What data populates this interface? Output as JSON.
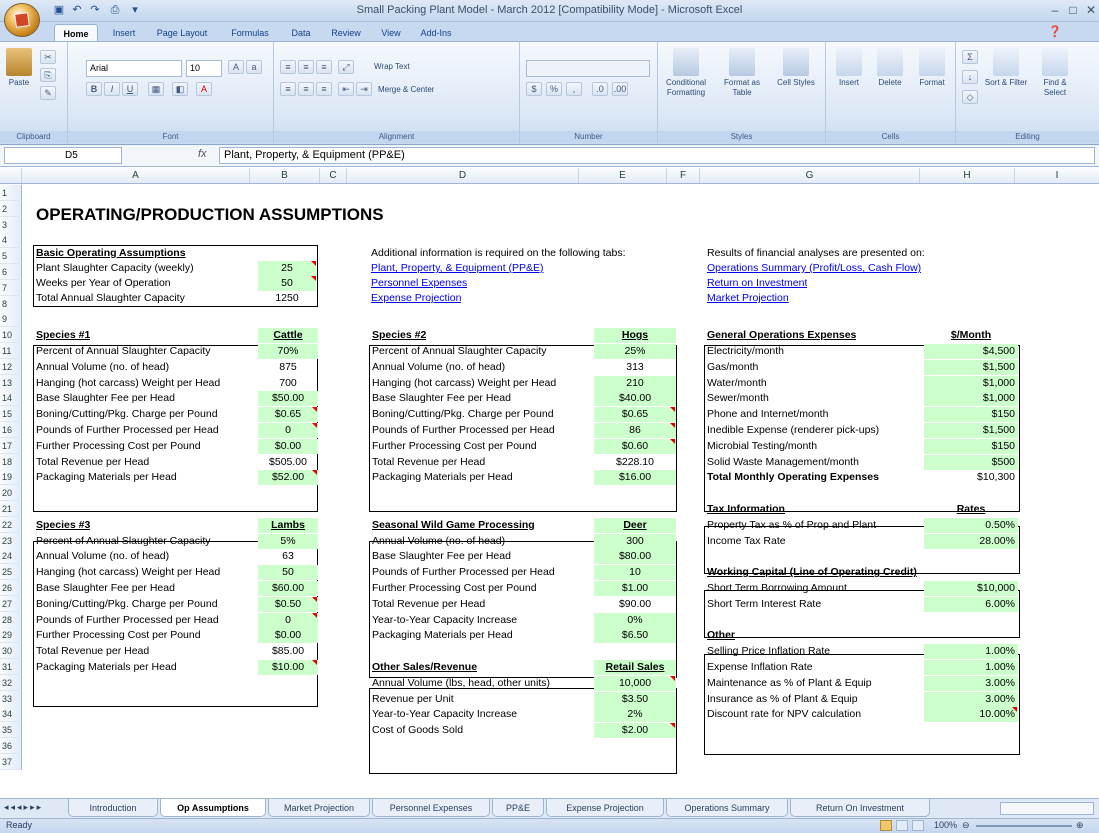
{
  "window": {
    "title": "Small Packing Plant Model - March 2012  [Compatibility Mode] - Microsoft Excel"
  },
  "ribbon_tabs": [
    "Home",
    "Insert",
    "Page Layout",
    "Formulas",
    "Data",
    "Review",
    "View",
    "Add-Ins"
  ],
  "ribbon": {
    "clipboard": {
      "paste": "Paste",
      "label": "Clipboard"
    },
    "font": {
      "name": "Arial",
      "size": "10",
      "label": "Font"
    },
    "alignment": {
      "wrap": "Wrap Text",
      "merge": "Merge & Center",
      "label": "Alignment"
    },
    "number": {
      "label": "Number"
    },
    "styles": {
      "cond": "Conditional Formatting",
      "format_table": "Format as Table",
      "cell_styles": "Cell Styles",
      "label": "Styles"
    },
    "cells": {
      "insert": "Insert",
      "delete": "Delete",
      "format": "Format",
      "label": "Cells"
    },
    "editing": {
      "sort": "Sort & Filter",
      "find": "Find & Select",
      "label": "Editing"
    }
  },
  "formula_bar": {
    "name_box": "D5",
    "fx": "fx",
    "formula": "Plant, Property, & Equipment (PP&E)"
  },
  "columns": [
    "A",
    "B",
    "C",
    "D",
    "E",
    "F",
    "G",
    "H",
    "I"
  ],
  "rows": [
    "1",
    "2",
    "3",
    "4",
    "5",
    "6",
    "7",
    "8",
    "9",
    "10",
    "11",
    "12",
    "13",
    "14",
    "15",
    "16",
    "17",
    "18",
    "19",
    "20",
    "21",
    "22",
    "23",
    "24",
    "25",
    "26",
    "27",
    "28",
    "29",
    "30",
    "31",
    "32",
    "33",
    "34",
    "35",
    "36",
    "37"
  ],
  "sheet": {
    "title": "OPERATING/PRODUCTION ASSUMPTIONS",
    "basic": {
      "header": "Basic Operating Assumptions",
      "items": [
        {
          "label": "Plant Slaughter Capacity (weekly)",
          "value": "25"
        },
        {
          "label": "Weeks per Year of Operation",
          "value": "50"
        },
        {
          "label": "Total Annual Slaughter Capacity",
          "value": "1250"
        }
      ]
    },
    "info": {
      "text": "Additional information is required on the following tabs:",
      "links": [
        "Plant, Property, & Equipment (PP&E)",
        "Personnel Expenses",
        "Expense Projection"
      ]
    },
    "results": {
      "text": "Results of financial analyses are presented on:",
      "links": [
        "Operations Summary (Profit/Loss, Cash Flow)",
        "Return on Investment",
        "Market Projection"
      ]
    },
    "species1": {
      "header": "Species #1",
      "col": "Cattle",
      "rows": [
        {
          "label": "Percent of Annual Slaughter Capacity",
          "value": "70%"
        },
        {
          "label": "Annual Volume (no. of head)",
          "value": "875"
        },
        {
          "label": "Hanging (hot carcass) Weight per Head",
          "value": "700"
        },
        {
          "label": "Base Slaughter Fee per Head",
          "value": "$50.00"
        },
        {
          "label": "Boning/Cutting/Pkg. Charge per Pound",
          "value": "$0.65"
        },
        {
          "label": "Pounds of Further Processed per Head",
          "value": "0"
        },
        {
          "label": "Further Processing Cost per Pound",
          "value": "$0.00"
        },
        {
          "label": "Total Revenue per Head",
          "value": "$505.00"
        },
        {
          "label": "Packaging Materials per Head",
          "value": "$52.00"
        }
      ]
    },
    "species2": {
      "header": "Species #2",
      "col": "Hogs",
      "rows": [
        {
          "label": "Percent of Annual Slaughter Capacity",
          "value": "25%"
        },
        {
          "label": "Annual Volume (no. of head)",
          "value": "313"
        },
        {
          "label": "Hanging (hot carcass) Weight per Head",
          "value": "210"
        },
        {
          "label": "Base Slaughter Fee per Head",
          "value": "$40.00"
        },
        {
          "label": "Boning/Cutting/Pkg. Charge per Pound",
          "value": "$0.65"
        },
        {
          "label": "Pounds of Further Processed per Head",
          "value": "86"
        },
        {
          "label": "Further Processing Cost per Pound",
          "value": "$0.60"
        },
        {
          "label": "Total Revenue per Head",
          "value": "$228.10"
        },
        {
          "label": "Packaging Materials per Head",
          "value": "$16.00"
        }
      ]
    },
    "species3": {
      "header": "Species #3",
      "col": "Lambs",
      "rows": [
        {
          "label": "Percent of Annual Slaughter Capacity",
          "value": "5%"
        },
        {
          "label": "Annual Volume (no. of head)",
          "value": "63"
        },
        {
          "label": "Hanging (hot carcass) Weight per Head",
          "value": "50"
        },
        {
          "label": "Base Slaughter Fee per Head",
          "value": "$60.00"
        },
        {
          "label": "Boning/Cutting/Pkg. Charge per Pound",
          "value": "$0.50"
        },
        {
          "label": "Pounds of Further Processed per Head",
          "value": "0"
        },
        {
          "label": "Further Processing Cost per Pound",
          "value": "$0.00"
        },
        {
          "label": "Total Revenue per Head",
          "value": "$85.00"
        },
        {
          "label": "Packaging Materials per Head",
          "value": "$10.00"
        }
      ]
    },
    "game": {
      "header": "Seasonal Wild Game Processing",
      "col": "Deer",
      "rows": [
        {
          "label": "Annual Volume (no. of head)",
          "value": "300"
        },
        {
          "label": "Base Slaughter Fee per Head",
          "value": "$80.00"
        },
        {
          "label": "Pounds of Further Processed per Head",
          "value": "10"
        },
        {
          "label": "Further Processing Cost per Pound",
          "value": "$1.00"
        },
        {
          "label": "Total Revenue per Head",
          "value": "$90.00"
        },
        {
          "label": "Year-to-Year Capacity Increase",
          "value": "0%"
        },
        {
          "label": "Packaging Materials per Head",
          "value": "$6.50"
        }
      ]
    },
    "other_sales": {
      "header": "Other Sales/Revenue",
      "col": "Retail Sales",
      "rows": [
        {
          "label": "Annual Volume (lbs, head, other units)",
          "value": "10,000"
        },
        {
          "label": "Revenue per Unit",
          "value": "$3.50"
        },
        {
          "label": "Year-to-Year Capacity Increase",
          "value": "2%"
        },
        {
          "label": "Cost of Goods Sold",
          "value": "$2.00"
        }
      ]
    },
    "genops": {
      "header": "General Operations Expenses",
      "col": "$/Month",
      "rows": [
        {
          "label": "Electricity/month",
          "value": "$4,500"
        },
        {
          "label": "Gas/month",
          "value": "$1,500"
        },
        {
          "label": "Water/month",
          "value": "$1,000"
        },
        {
          "label": "Sewer/month",
          "value": "$1,000"
        },
        {
          "label": "Phone and Internet/month",
          "value": "$150"
        },
        {
          "label": "Inedible Expense (renderer pick-ups)",
          "value": "$1,500"
        },
        {
          "label": "Microbial Testing/month",
          "value": "$150"
        },
        {
          "label": "Solid Waste Management/month",
          "value": "$500"
        }
      ],
      "total_label": "Total Monthly Operating Expenses",
      "total_value": "$10,300"
    },
    "tax": {
      "header": "Tax Information",
      "col": "Rates",
      "rows": [
        {
          "label": "Property Tax as % of Prop and Plant",
          "value": "0.50%"
        },
        {
          "label": "Income Tax Rate",
          "value": "28.00%"
        }
      ]
    },
    "wc": {
      "header": "Working Capital (Line of Operating Credit)",
      "rows": [
        {
          "label": "Short Term Borrowing Amount",
          "value": "$10,000"
        },
        {
          "label": "Short Term Interest Rate",
          "value": "6.00%"
        }
      ]
    },
    "other": {
      "header": "Other",
      "rows": [
        {
          "label": "Selling Price Inflation Rate",
          "value": "1.00%"
        },
        {
          "label": "Expense Inflation Rate",
          "value": "1.00%"
        },
        {
          "label": "Maintenance as % of Plant & Equip",
          "value": "3.00%"
        },
        {
          "label": "Insurance as % of Plant & Equip",
          "value": "3.00%"
        },
        {
          "label": "Discount rate for NPV calculation",
          "value": "10.00%"
        }
      ]
    }
  },
  "sheet_tabs": [
    "Introduction",
    "Op Assumptions",
    "Market Projection",
    "Personnel Expenses",
    "PP&E",
    "Expense Projection",
    "Operations Summary",
    "Return On Investment"
  ],
  "status": {
    "ready": "Ready",
    "zoom": "100%"
  }
}
